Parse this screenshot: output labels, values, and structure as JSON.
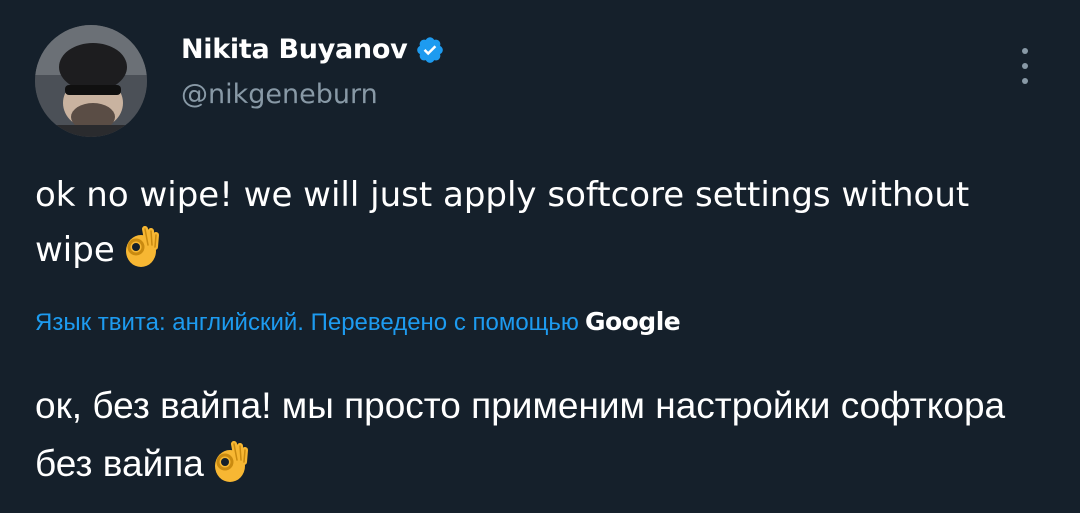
{
  "author": {
    "name": "Nikita Buyanov",
    "handle": "@nikgeneburn",
    "verified": true,
    "avatar_icon": "avatar-photo"
  },
  "tweet": {
    "text": "ok no wipe! we will just apply softcore settings without wipe",
    "emoji": "ok-hand-emoji"
  },
  "translation": {
    "label": "Язык твита: английский. Переведено с помощью",
    "provider": "Google",
    "text": "ок, без вайпа! мы просто применим настройки софткора без вайпа",
    "emoji": "ok-hand-emoji"
  },
  "colors": {
    "background": "#15202b",
    "accent": "#1d9bf0",
    "secondary_text": "#8899a6"
  }
}
